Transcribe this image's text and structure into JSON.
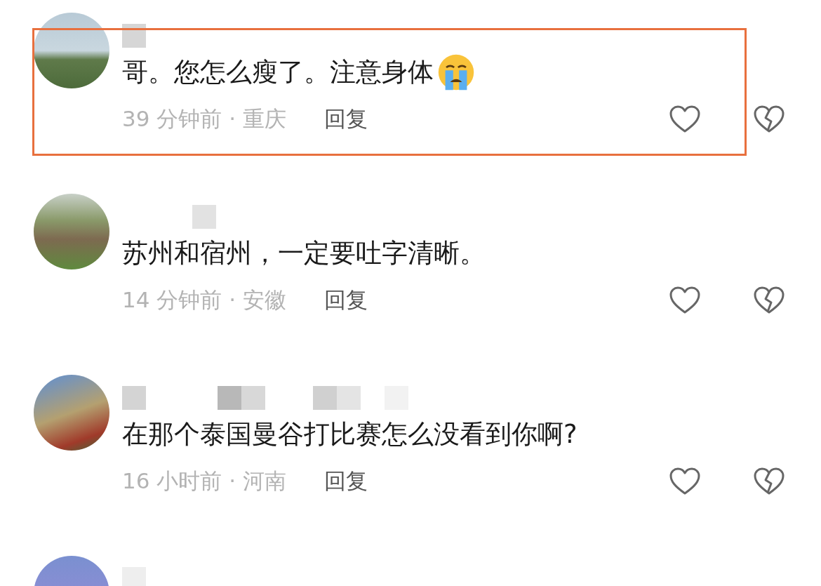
{
  "comments": [
    {
      "kind": "full",
      "highlighted": true,
      "text": "哥。您怎么瘦了。注意身体",
      "emoji": true,
      "time": "39 分钟前 · 重庆",
      "reply": "回复"
    },
    {
      "kind": "full",
      "highlighted": false,
      "text": "苏州和宿州，一定要吐字清晰。",
      "emoji": false,
      "time": "14 分钟前 · 安徽",
      "reply": "回复"
    },
    {
      "kind": "full",
      "highlighted": false,
      "text": "在那个泰国曼谷打比赛怎么没看到你啊?",
      "emoji": false,
      "time": "16 小时前 · 河南",
      "reply": "回复"
    },
    {
      "kind": "partial",
      "highlighted": false
    }
  ]
}
